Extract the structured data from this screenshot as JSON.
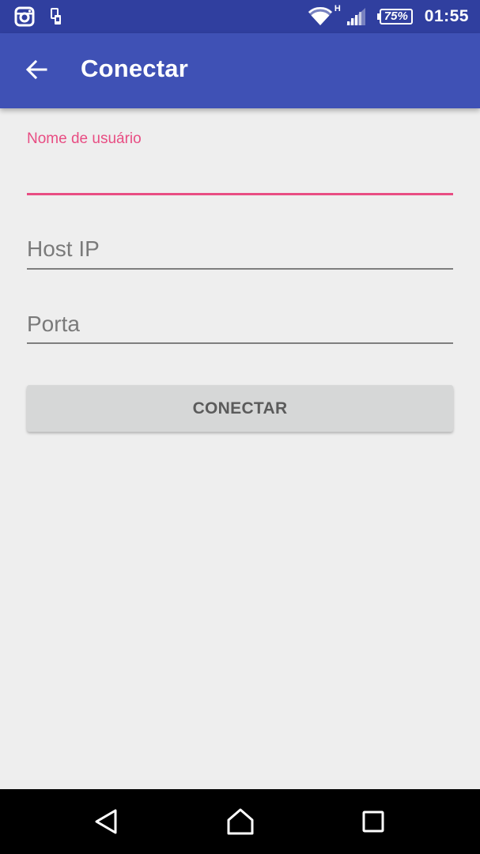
{
  "status_bar": {
    "icons_left": [
      "instagram-icon",
      "device-icon"
    ],
    "network_type": "H",
    "battery": "75%",
    "clock": "01:55"
  },
  "app_bar": {
    "title": "Conectar",
    "back_icon": "arrow-back-icon"
  },
  "form": {
    "username": {
      "label": "Nome de usuário",
      "value": "",
      "focused": true
    },
    "host": {
      "placeholder": "Host IP",
      "value": ""
    },
    "port": {
      "placeholder": "Porta",
      "value": ""
    },
    "connect_label": "CONECTAR"
  },
  "nav_bar": {
    "icons": [
      "back-triangle-icon",
      "home-icon",
      "recents-icon"
    ]
  },
  "colors": {
    "primary": "#3f51b5",
    "primary_dark": "#303f9f",
    "accent": "#e84d83",
    "background": "#eeeeee",
    "button": "#d6d7d7"
  }
}
